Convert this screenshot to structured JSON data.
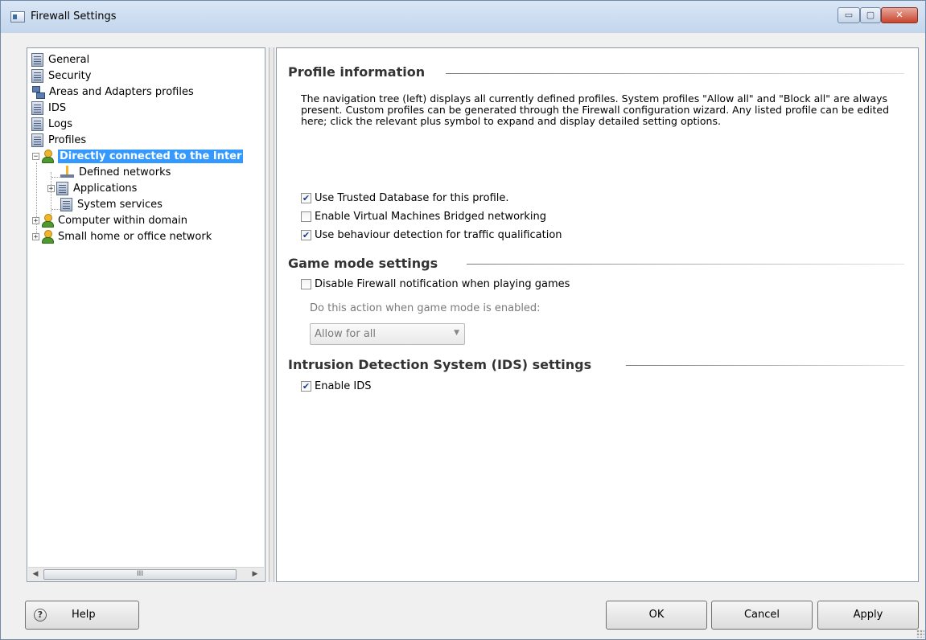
{
  "window": {
    "title": "Firewall Settings",
    "controls": {
      "minimize": "▭",
      "maximize": "▢",
      "close": "✕"
    }
  },
  "tree": {
    "items": [
      {
        "label": "General",
        "icon": "document-list-icon"
      },
      {
        "label": "Security",
        "icon": "document-list-icon"
      },
      {
        "label": "Areas and Adapters profiles",
        "icon": "network-icon"
      },
      {
        "label": "IDS",
        "icon": "document-list-icon"
      },
      {
        "label": "Logs",
        "icon": "document-list-icon"
      },
      {
        "label": "Profiles",
        "icon": "document-list-icon"
      },
      {
        "label": "Directly connected to the Inter",
        "icon": "user-icon",
        "expanded": true,
        "selected": true
      },
      {
        "label": "Defined networks",
        "icon": "network-icon"
      },
      {
        "label": "Applications",
        "icon": "document-list-icon",
        "expander": "+"
      },
      {
        "label": "System services",
        "icon": "document-list-icon"
      },
      {
        "label": "Computer within domain",
        "icon": "user-icon",
        "expander": "+"
      },
      {
        "label": "Small home or office network",
        "icon": "user-icon",
        "expander": "+"
      }
    ],
    "scrollbar": {
      "left_arrow": "◀",
      "right_arrow": "▶",
      "thumb_grip": "III"
    }
  },
  "profile_information": {
    "title": "Profile information",
    "description": "The navigation tree (left) displays all currently defined profiles. System profiles \"Allow all\" and \"Block all\" are always present. Custom profiles can be generated through the Firewall configuration wizard. Any listed profile can be edited here; click the relevant plus symbol to expand and display detailed setting options.",
    "options": [
      {
        "label": "Use Trusted Database for this profile.",
        "checked": true
      },
      {
        "label": "Enable Virtual Machines Bridged networking",
        "checked": false
      },
      {
        "label": "Use behaviour detection for traffic qualification",
        "checked": true
      }
    ]
  },
  "game_mode": {
    "title": "Game mode settings",
    "disable_notification": {
      "label": "Disable Firewall notification when playing games",
      "checked": false
    },
    "action_label": "Do this action when game mode is enabled:",
    "action_value": "Allow for all",
    "enabled": false
  },
  "ids": {
    "title": "Intrusion Detection System (IDS) settings",
    "enable": {
      "label": "Enable IDS",
      "checked": true
    }
  },
  "buttons": {
    "help": "Help",
    "help_icon": "?",
    "ok": "OK",
    "cancel": "Cancel",
    "apply": "Apply"
  },
  "colors": {
    "selection": "#3399ff",
    "window_bg": "#f0f0f0",
    "title_bar": "#c3d6ec"
  }
}
